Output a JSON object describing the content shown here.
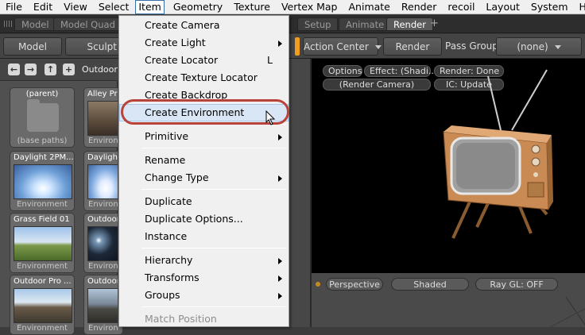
{
  "menubar": {
    "items": [
      "File",
      "Edit",
      "View",
      "Select",
      "Item",
      "Geometry",
      "Texture",
      "Vertex Map",
      "Animate",
      "Render",
      "recoil",
      "Layout",
      "System",
      "Help"
    ],
    "active": "Item"
  },
  "layout_tabs": [
    "Model",
    "Model Quad",
    "Setup",
    "Animate",
    "Render"
  ],
  "active_layout_tab": "Render",
  "add_tab": "+",
  "toolbar": {
    "model": "Model",
    "sculpt_partial": "Sculpt",
    "action_center": "Action Center",
    "render": "Render",
    "pass_groups_label": "Pass Groups",
    "pass_groups_value": "(none)"
  },
  "browser": {
    "path_label": "Outdoor",
    "thumbnails": [
      {
        "title": "(parent)",
        "caption": "(base paths)"
      },
      {
        "title": "Alley Pr",
        "caption": "Environ"
      },
      {
        "title": "Daylight 2PM...",
        "caption": "Environment"
      },
      {
        "title": "Daylight",
        "caption": "Environ"
      },
      {
        "title": "Grass Field 01",
        "caption": "Environment"
      },
      {
        "title": "Outdoor",
        "caption": "Environ"
      },
      {
        "title": "Outdoor Pro ...",
        "caption": "Environment"
      },
      {
        "title": "Outdoor",
        "caption": "Environ"
      }
    ]
  },
  "viewport": {
    "options": "Options",
    "effect": "Effect: (Shadi...",
    "render_status": "Render: Done",
    "camera": "(Render Camera)",
    "ic": "IC: Update"
  },
  "bottom_view": {
    "perspective": "Perspective",
    "shaded": "Shaded",
    "raygl": "Ray GL: OFF"
  },
  "item_menu": {
    "items": [
      {
        "label": "Create Camera"
      },
      {
        "label": "Create Light",
        "submenu": true
      },
      {
        "label": "Create Locator",
        "shortcut": "L"
      },
      {
        "label": "Create Texture Locator"
      },
      {
        "label": "Create Backdrop"
      },
      {
        "label": "Create Environment",
        "highlighted": true
      },
      {
        "label": "Primitive",
        "submenu": true
      },
      {
        "label": "Rename"
      },
      {
        "label": "Change Type",
        "submenu": true
      },
      {
        "label": "Duplicate"
      },
      {
        "label": "Duplicate Options..."
      },
      {
        "label": "Instance"
      },
      {
        "label": "Hierarchy",
        "submenu": true
      },
      {
        "label": "Transforms",
        "submenu": true
      },
      {
        "label": "Groups",
        "submenu": true
      },
      {
        "label": "Match Position",
        "disabled": true
      }
    ]
  },
  "colors": {
    "highlight_ring": "#b8433a",
    "accent_orange": "#f09c1c",
    "active_tab": "#5a5a5a"
  }
}
